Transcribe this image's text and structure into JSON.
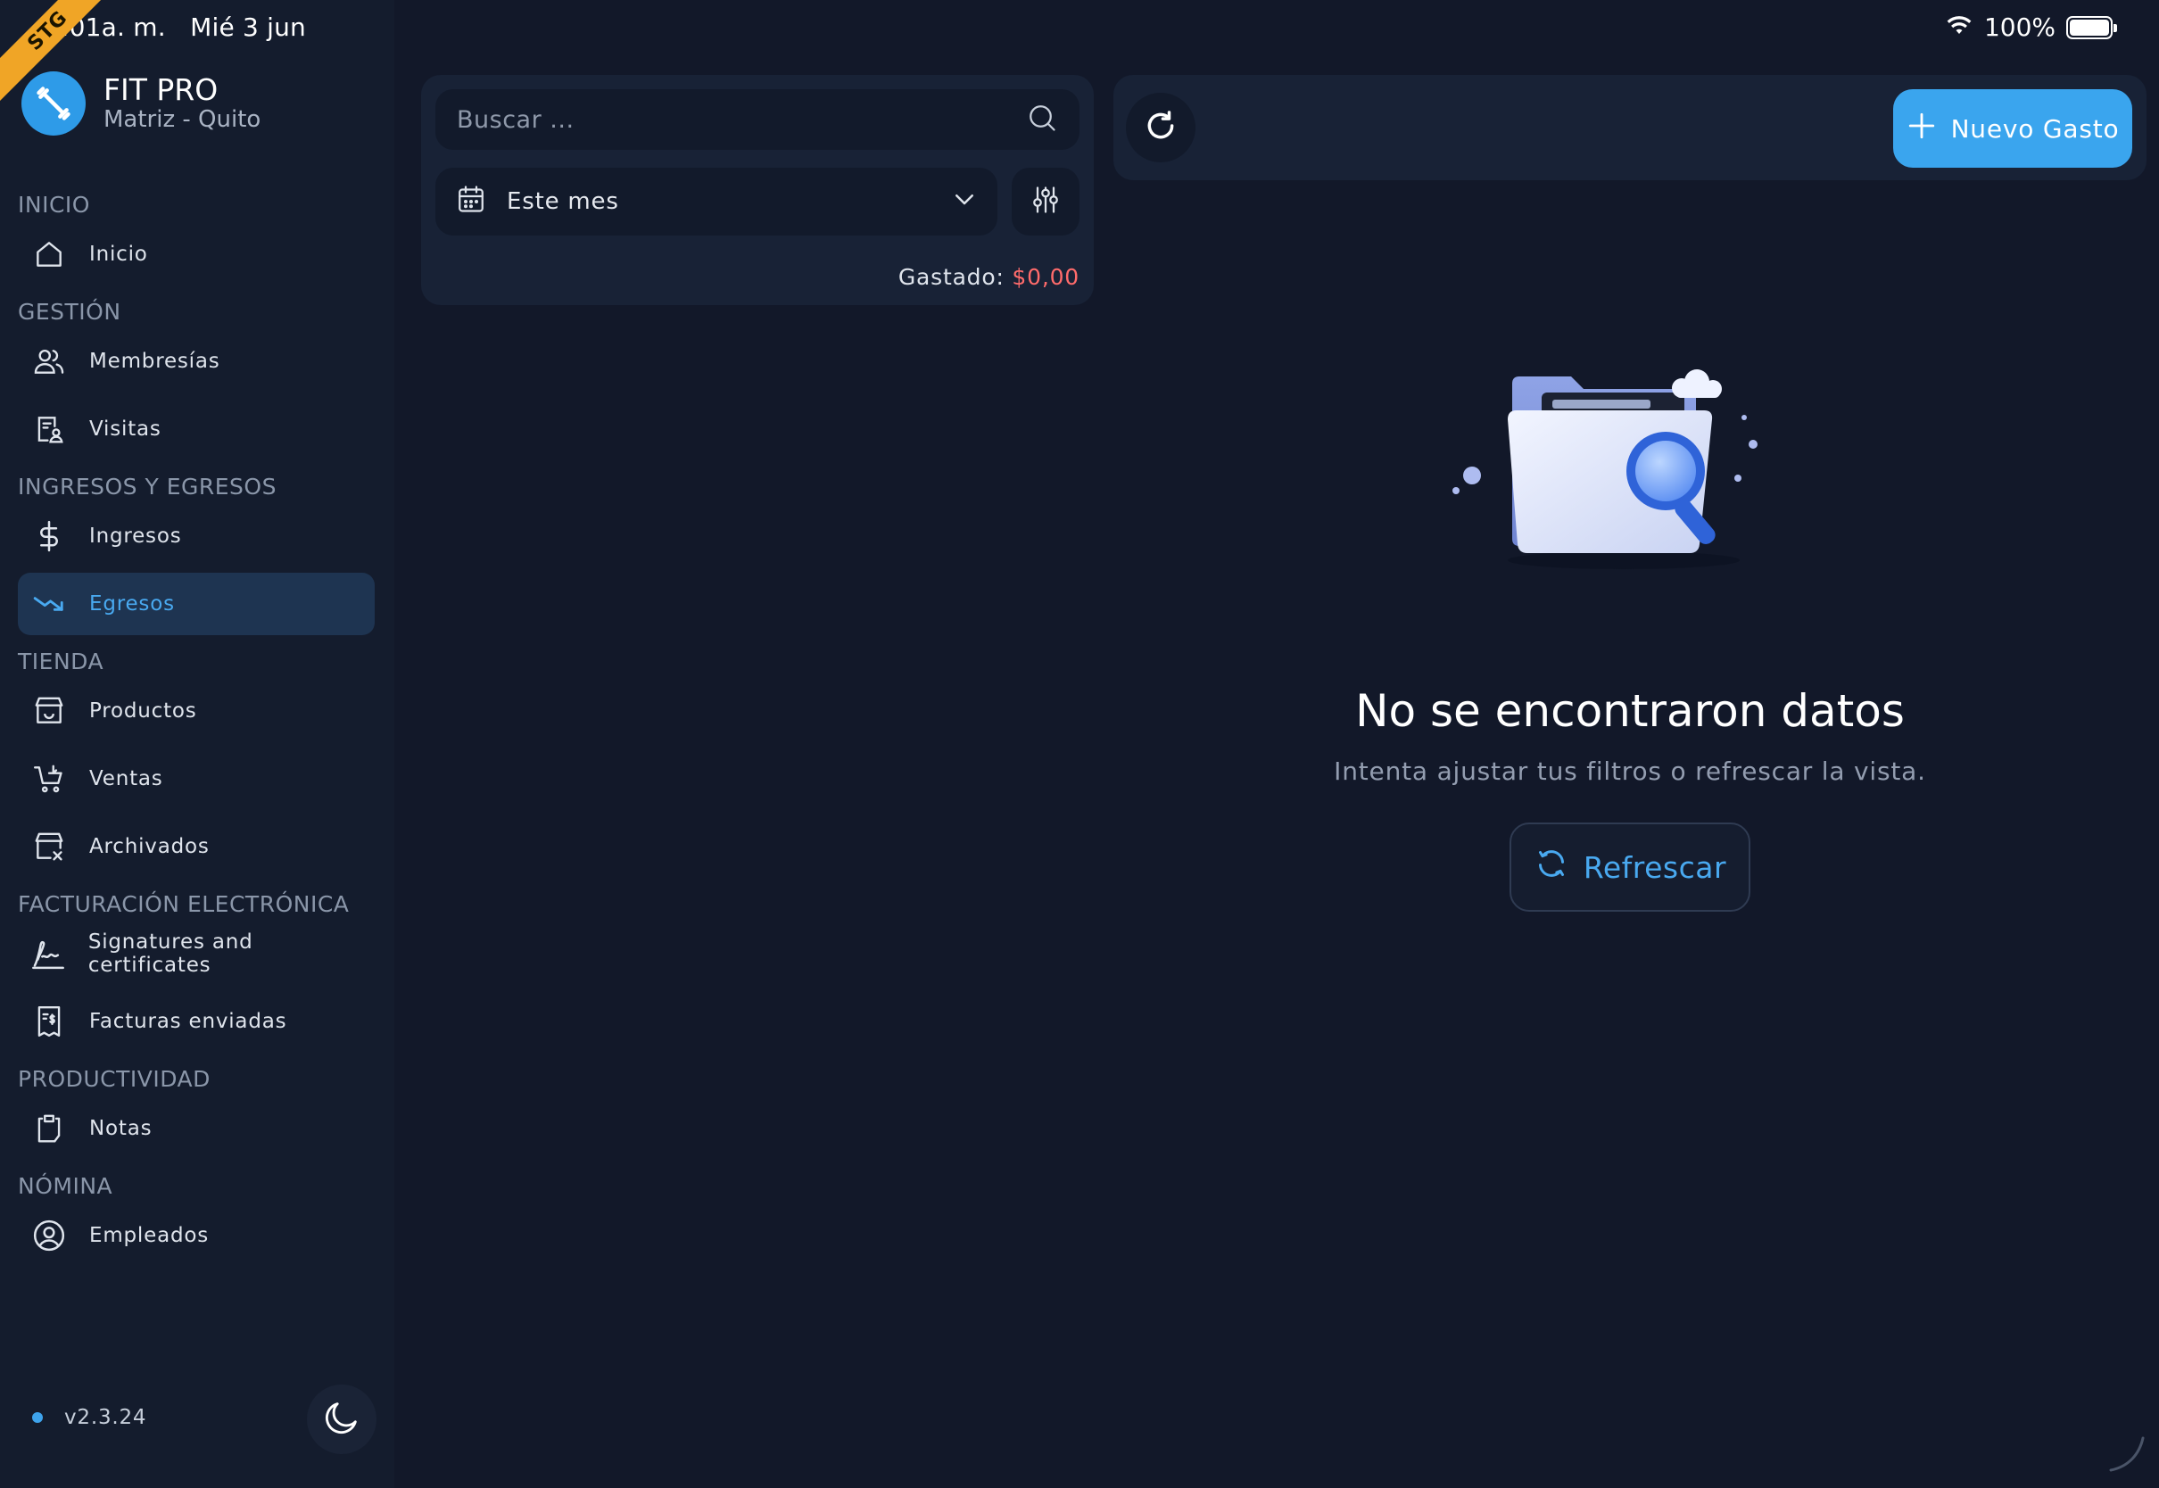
{
  "status_bar": {
    "time": "8:01a. m.",
    "date": "Mié 3 jun",
    "battery": "100%"
  },
  "ribbon": "STG",
  "brand": {
    "title": "FIT PRO",
    "subtitle": "Matriz - Quito",
    "logo_icon": "dumbbell-icon"
  },
  "sidebar": {
    "sections": [
      {
        "title": "INICIO",
        "items": [
          {
            "label": "Inicio",
            "icon": "home-icon"
          }
        ]
      },
      {
        "title": "GESTIÓN",
        "items": [
          {
            "label": "Membresías",
            "icon": "users-icon"
          },
          {
            "label": "Visitas",
            "icon": "visitor-badge-icon"
          }
        ]
      },
      {
        "title": "INGRESOS Y EGRESOS",
        "items": [
          {
            "label": "Ingresos",
            "icon": "dollar-icon"
          },
          {
            "label": "Egresos",
            "icon": "trend-down-icon",
            "active": true
          }
        ]
      },
      {
        "title": "TIENDA",
        "items": [
          {
            "label": "Productos",
            "icon": "store-icon"
          },
          {
            "label": "Ventas",
            "icon": "cart-icon"
          },
          {
            "label": "Archivados",
            "icon": "store-archived-icon"
          }
        ]
      },
      {
        "title": "FACTURACIÓN ELECTRÓNICA",
        "items": [
          {
            "label": "Signatures and certificates",
            "icon": "signature-icon"
          },
          {
            "label": "Facturas enviadas",
            "icon": "receipt-icon"
          }
        ]
      },
      {
        "title": "PRODUCTIVIDAD",
        "items": [
          {
            "label": "Notas",
            "icon": "clipboard-icon"
          }
        ]
      },
      {
        "title": "NÓMINA",
        "items": [
          {
            "label": "Empleados",
            "icon": "user-circle-icon"
          }
        ]
      }
    ],
    "version": "v2.3.24",
    "theme_icon": "moon-icon"
  },
  "filters": {
    "search_placeholder": "Buscar ...",
    "date_range": "Este mes",
    "spent_label": "Gastado:",
    "spent_amount": "$0,00"
  },
  "toolbar": {
    "new_button": "Nuevo Gasto"
  },
  "empty_state": {
    "title": "No se encontraron datos",
    "subtitle": "Intenta ajustar tus filtros o refrescar la vista.",
    "button": "Refrescar",
    "illustration": "folder-search-illustration"
  },
  "colors": {
    "background": "#121829",
    "sidebar": "#141c2d",
    "accent": "#3aa5ee",
    "active_bg": "#1e3451",
    "danger": "#ff6b6b"
  }
}
